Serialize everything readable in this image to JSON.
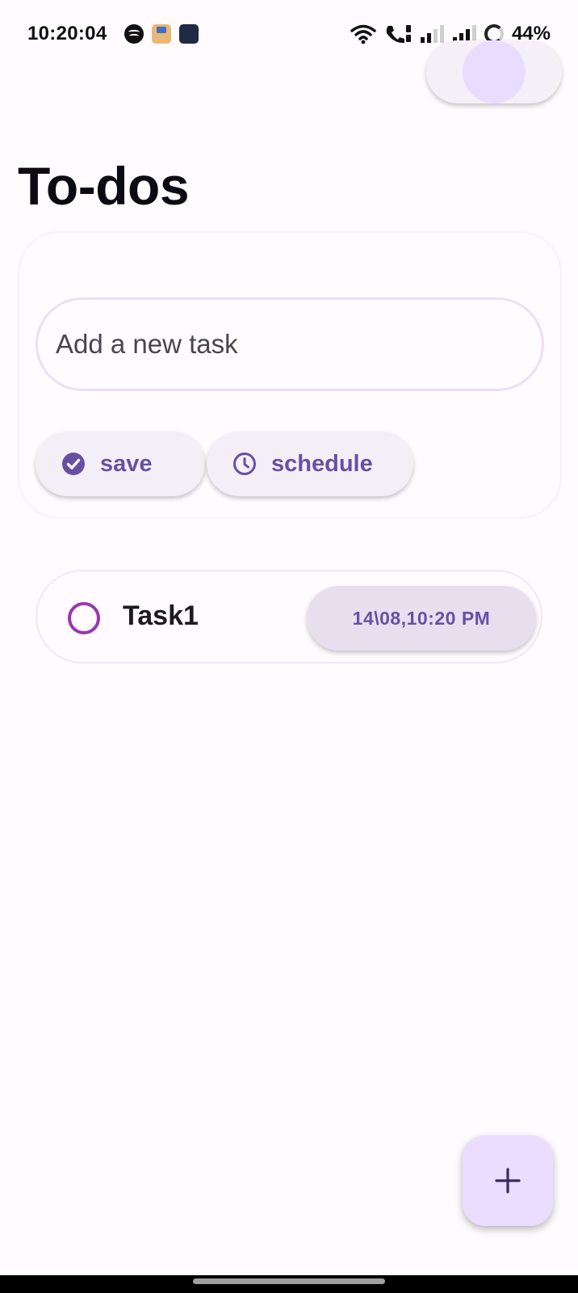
{
  "status_bar": {
    "time": "10:20:04",
    "battery": "44%",
    "notification_icons": [
      "spotify-icon",
      "package-app-icon",
      "dark-app-icon"
    ],
    "system_icons": [
      "wifi-icon",
      "wifi-calling-icon",
      "signal-icon-sim1",
      "signal-icon-sim2",
      "battery-saver-icon"
    ]
  },
  "header": {
    "title": "To-dos",
    "theme_toggle": {
      "state": "off"
    }
  },
  "new_task": {
    "placeholder": "Add a new task",
    "value": "",
    "save_label": "save",
    "save_icon": "check-circle-icon",
    "schedule_label": "schedule",
    "schedule_icon": "clock-icon"
  },
  "tasks": [
    {
      "name": "Task1",
      "time": "14\\08,10:20 PM",
      "done": false
    }
  ],
  "fab": {
    "icon": "plus-icon"
  },
  "colors": {
    "primary": "#6750a4",
    "checkbox": "#9a36b0",
    "chip_bg": "#f4eff6",
    "fab_bg": "#eaddff",
    "toggle_knob": "#e9ddff"
  }
}
